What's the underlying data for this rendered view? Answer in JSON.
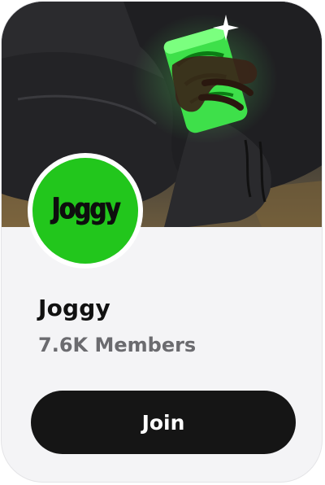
{
  "community": {
    "name": "Joggy",
    "members": "7.6K Members",
    "avatar_logo_text": "Joggy",
    "join_label": "Join"
  },
  "colors": {
    "card_background": "#f4f4f6",
    "avatar_green": "#22c61c",
    "button_background": "#151515",
    "button_text": "#ffffff",
    "members_text": "#6b6b6f"
  },
  "icons": [
    "cover-photo",
    "community-avatar"
  ]
}
